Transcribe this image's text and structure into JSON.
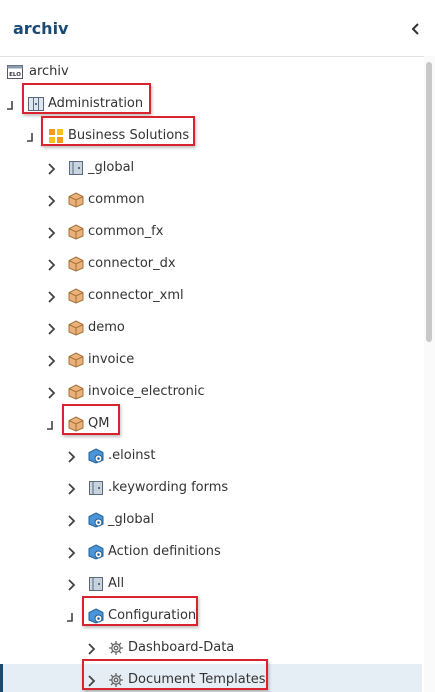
{
  "header": {
    "title": "archiv"
  },
  "tree": {
    "items": [
      {
        "label": "archiv",
        "icon": "elo-archive-icon",
        "expander": "none"
      },
      {
        "label": "Administration",
        "icon": "cabinet-icon",
        "expander": "expanded"
      },
      {
        "label": "Business Solutions",
        "icon": "business-solutions-icon",
        "expander": "expanded"
      },
      {
        "label": "_global",
        "icon": "folder-gray-icon",
        "expander": "collapsed"
      },
      {
        "label": "common",
        "icon": "package-icon",
        "expander": "collapsed"
      },
      {
        "label": "common_fx",
        "icon": "package-icon",
        "expander": "collapsed"
      },
      {
        "label": "connector_dx",
        "icon": "package-icon",
        "expander": "collapsed"
      },
      {
        "label": "connector_xml",
        "icon": "package-icon",
        "expander": "collapsed"
      },
      {
        "label": "demo",
        "icon": "package-icon",
        "expander": "collapsed"
      },
      {
        "label": "invoice",
        "icon": "package-icon",
        "expander": "collapsed"
      },
      {
        "label": "invoice_electronic",
        "icon": "package-icon",
        "expander": "collapsed"
      },
      {
        "label": "QM",
        "icon": "package-icon",
        "expander": "expanded"
      },
      {
        "label": ".eloinst",
        "icon": "gear-cube-icon",
        "expander": "collapsed"
      },
      {
        "label": ".keywording forms",
        "icon": "folder-gray-icon",
        "expander": "collapsed"
      },
      {
        "label": "_global",
        "icon": "gear-cube-icon",
        "expander": "collapsed"
      },
      {
        "label": "Action definitions",
        "icon": "gear-cube-icon",
        "expander": "collapsed"
      },
      {
        "label": "All",
        "icon": "folder-gray-icon",
        "expander": "collapsed"
      },
      {
        "label": "Configuration",
        "icon": "gear-cube-icon",
        "expander": "expanded"
      },
      {
        "label": "Dashboard-Data",
        "icon": "gear-icon",
        "expander": "collapsed"
      },
      {
        "label": "Document Templates",
        "icon": "gear-icon",
        "expander": "collapsed"
      }
    ]
  },
  "colors": {
    "accent": "#1a4a73",
    "highlight_border": "#d9232d",
    "selected_row": "#e6eef5",
    "package": "#d9a066",
    "gear_cube": "#2f7fc8"
  }
}
